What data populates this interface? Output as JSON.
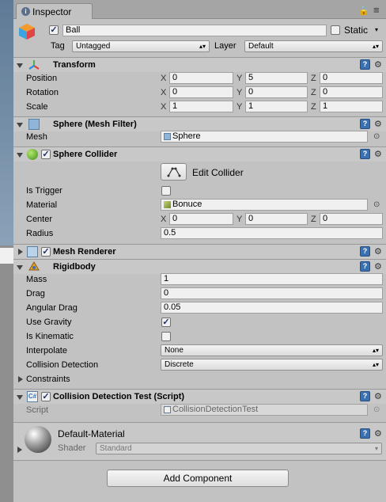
{
  "tab": {
    "label": "Inspector"
  },
  "object": {
    "name": "Ball",
    "active": true,
    "static_label": "Static",
    "tag_label": "Tag",
    "tag_value": "Untagged",
    "layer_label": "Layer",
    "layer_value": "Default"
  },
  "transform": {
    "title": "Transform",
    "rows": [
      {
        "label": "Position",
        "x": "0",
        "y": "5",
        "z": "0"
      },
      {
        "label": "Rotation",
        "x": "0",
        "y": "0",
        "z": "0"
      },
      {
        "label": "Scale",
        "x": "1",
        "y": "1",
        "z": "1"
      }
    ],
    "axis": {
      "x": "X",
      "y": "Y",
      "z": "Z"
    }
  },
  "mesh_filter": {
    "title": "Sphere (Mesh Filter)",
    "mesh_label": "Mesh",
    "mesh_value": "Sphere"
  },
  "sphere_collider": {
    "title": "Sphere Collider",
    "edit_label": "Edit Collider",
    "is_trigger_label": "Is Trigger",
    "material_label": "Material",
    "material_value": "Bonuce",
    "center_label": "Center",
    "center": {
      "x": "0",
      "y": "0",
      "z": "0"
    },
    "radius_label": "Radius",
    "radius_value": "0.5"
  },
  "mesh_renderer": {
    "title": "Mesh Renderer"
  },
  "rigidbody": {
    "title": "Rigidbody",
    "mass_label": "Mass",
    "mass_value": "1",
    "drag_label": "Drag",
    "drag_value": "0",
    "angular_drag_label": "Angular Drag",
    "angular_drag_value": "0.05",
    "use_gravity_label": "Use Gravity",
    "use_gravity": true,
    "is_kinematic_label": "Is Kinematic",
    "is_kinematic": false,
    "interpolate_label": "Interpolate",
    "interpolate_value": "None",
    "collision_label": "Collision Detection",
    "collision_value": "Discrete",
    "constraints_label": "Constraints"
  },
  "script": {
    "title": "Collision Detection Test (Script)",
    "script_label": "Script",
    "script_value": "CollisionDetectionTest"
  },
  "material": {
    "name": "Default-Material",
    "shader_label": "Shader",
    "shader_value": "Standard"
  },
  "add_component": {
    "label": "Add Component"
  },
  "colors": {
    "accent": "#3a6fb0",
    "panel": "#c2c2c2"
  }
}
